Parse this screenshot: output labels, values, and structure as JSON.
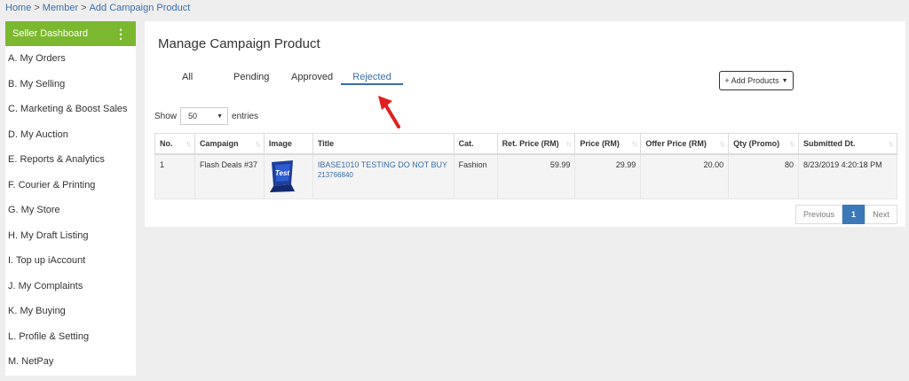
{
  "breadcrumb": [
    "Home",
    "Member",
    "Add Campaign Product"
  ],
  "sidebar": {
    "header": "Seller Dashboard",
    "items": [
      "A. My Orders",
      "B. My Selling",
      "C. Marketing & Boost Sales",
      "D. My Auction",
      "E. Reports & Analytics",
      "F. Courier & Printing",
      "G. My Store",
      "H. My Draft Listing",
      "I.  Top up iAccount",
      "J. My Complaints",
      "K. My Buying",
      "L. Profile & Setting",
      "M. NetPay"
    ]
  },
  "page_title": "Manage Campaign Product",
  "tabs": [
    {
      "label": "All",
      "active": false
    },
    {
      "label": "Pending",
      "active": false
    },
    {
      "label": "Approved",
      "active": false
    },
    {
      "label": "Rejected",
      "active": true
    }
  ],
  "add_button": "+ Add Products",
  "show": {
    "prefix": "Show",
    "value": "50",
    "suffix": "entries"
  },
  "table": {
    "headers": [
      "No.",
      "Campaign",
      "Image",
      "Title",
      "Cat.",
      "Ret. Price (RM)",
      "Price (RM)",
      "Offer Price (RM)",
      "Qty (Promo)",
      "Submitted Dt."
    ],
    "rows": [
      {
        "no": "1",
        "campaign": "Flash Deals #37",
        "image_icon": "test-key-product-image",
        "title": "IBASE1010 TESTING DO NOT BUY",
        "sub": "213766840",
        "cat": "Fashion",
        "ret_price": "59.99",
        "price": "29.99",
        "offer_price": "20.00",
        "qty": "80",
        "submitted": "8/23/2019 4:20:18 PM"
      }
    ]
  },
  "pager": {
    "prev": "Previous",
    "current": "1",
    "next": "Next"
  },
  "colors": {
    "accent_green": "#7cb82f",
    "link_blue": "#3a6ea5",
    "arrow_red": "#e02020"
  }
}
